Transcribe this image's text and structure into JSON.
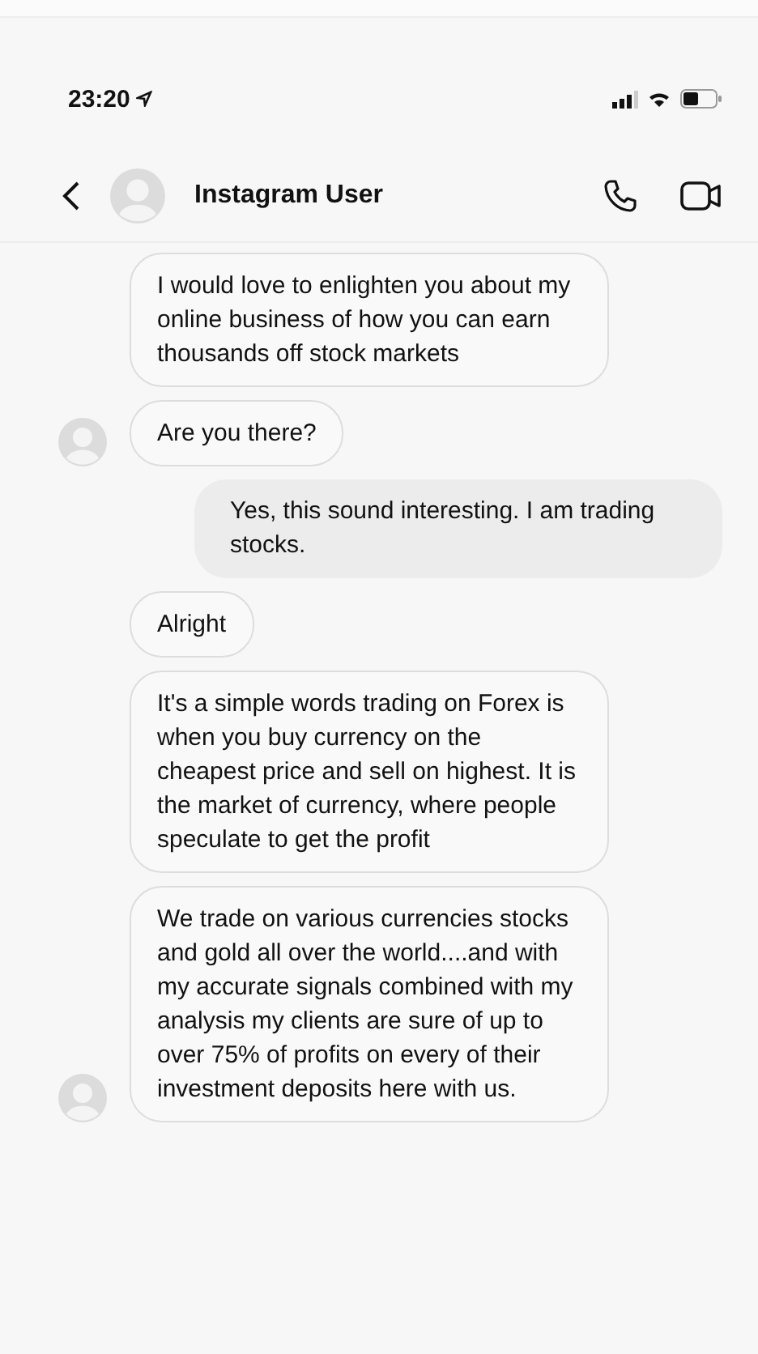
{
  "status_bar": {
    "time": "23:20"
  },
  "header": {
    "title": "Instagram User"
  },
  "messages": [
    {
      "kind": "received",
      "text": "I would love to enlighten you about my online business of how you can earn thousands off stock markets",
      "avatar": false
    },
    {
      "kind": "received",
      "text": "Are you there?",
      "avatar": true
    },
    {
      "kind": "sent",
      "text": "Yes, this sound interesting. I am trading stocks.",
      "avatar": false
    },
    {
      "kind": "received",
      "text": "Alright",
      "avatar": false
    },
    {
      "kind": "received",
      "text": "It's a simple words trading on Forex is when you buy currency on the cheapest price and sell on highest. It is the market of currency, where people speculate to get the profit",
      "avatar": false
    },
    {
      "kind": "received",
      "text": "We trade on various currencies stocks and gold all over the world....and with my accurate signals combined with my analysis my clients are sure of up to over 75% of profits on every of their investment deposits here with us.",
      "avatar": true
    }
  ]
}
